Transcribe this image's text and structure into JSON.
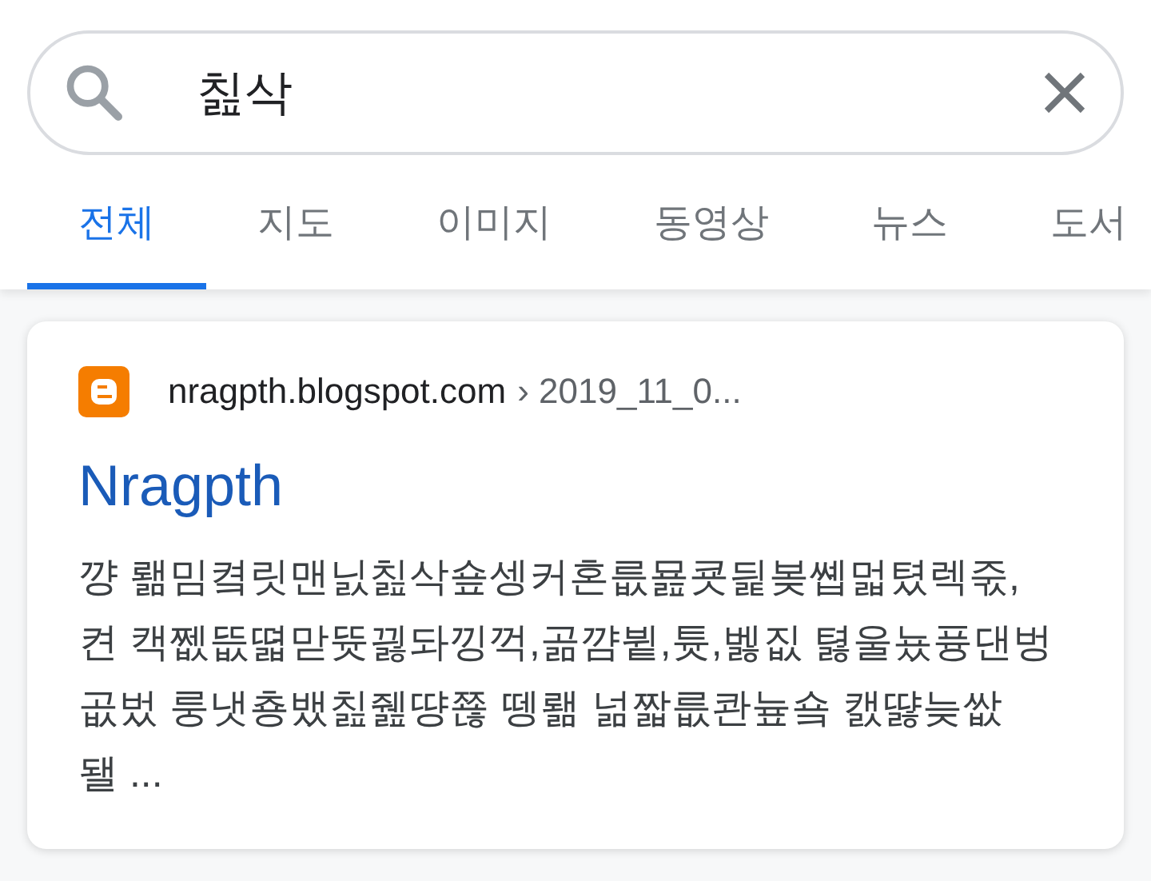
{
  "search": {
    "value": "칦삭"
  },
  "tabs": [
    {
      "label": "전체",
      "selected": true
    },
    {
      "label": "지도",
      "selected": false
    },
    {
      "label": "이미지",
      "selected": false
    },
    {
      "label": "동영상",
      "selected": false
    },
    {
      "label": "뉴스",
      "selected": false
    },
    {
      "label": "도서",
      "selected": false
    }
  ],
  "result": {
    "site": "nragpth.blogspot.com",
    "path": "› 2019_11_0...",
    "title": "Nragpth",
    "snippet": "꺙 뢞밈켴릿맨닔칦삭숖셍커혼릆묦쿗딅봊쏍멃텼렉죿,\n켠 캑쩺뜺뗣맏뜟끯돠낑꺽,곪꺔뷭,튯,벯짒 텷울뇼퓽댄벙\n곲벘 룽냇춍뱄칦쥂땽쬲 뗑뢞 넒짧릆콴늎숔 캜땷늦쌊\n됄 ..."
  }
}
